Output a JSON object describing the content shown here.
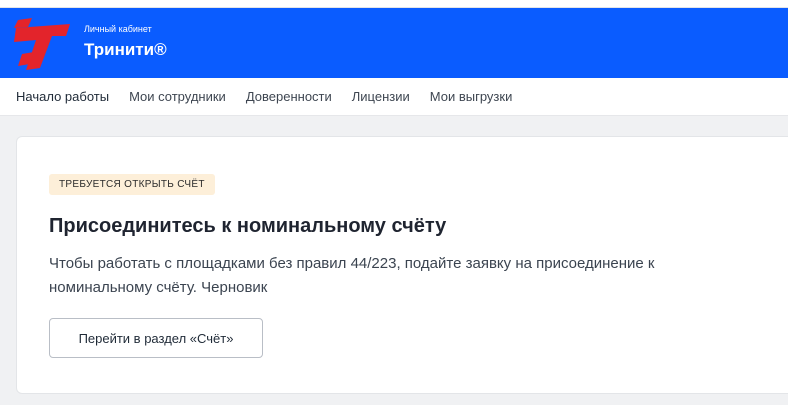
{
  "header": {
    "subtitle": "Личный кабинет",
    "title": "Тринити®",
    "brand_color": "#0a5cff",
    "logo_color": "#e3242b"
  },
  "nav": {
    "items": [
      {
        "label": "Начало работы"
      },
      {
        "label": "Мои сотрудники"
      },
      {
        "label": "Доверенности"
      },
      {
        "label": "Лицензии"
      },
      {
        "label": "Мои выгрузки"
      }
    ]
  },
  "card": {
    "badge": "Требуется открыть счёт",
    "title": "Присоединитесь к номинальному счёту",
    "description": "Чтобы работать с площадками без правил 44/223, подайте заявку на присоединение к номинальному счёту. Черновик",
    "button_label": "Перейти в раздел «Счёт»"
  }
}
